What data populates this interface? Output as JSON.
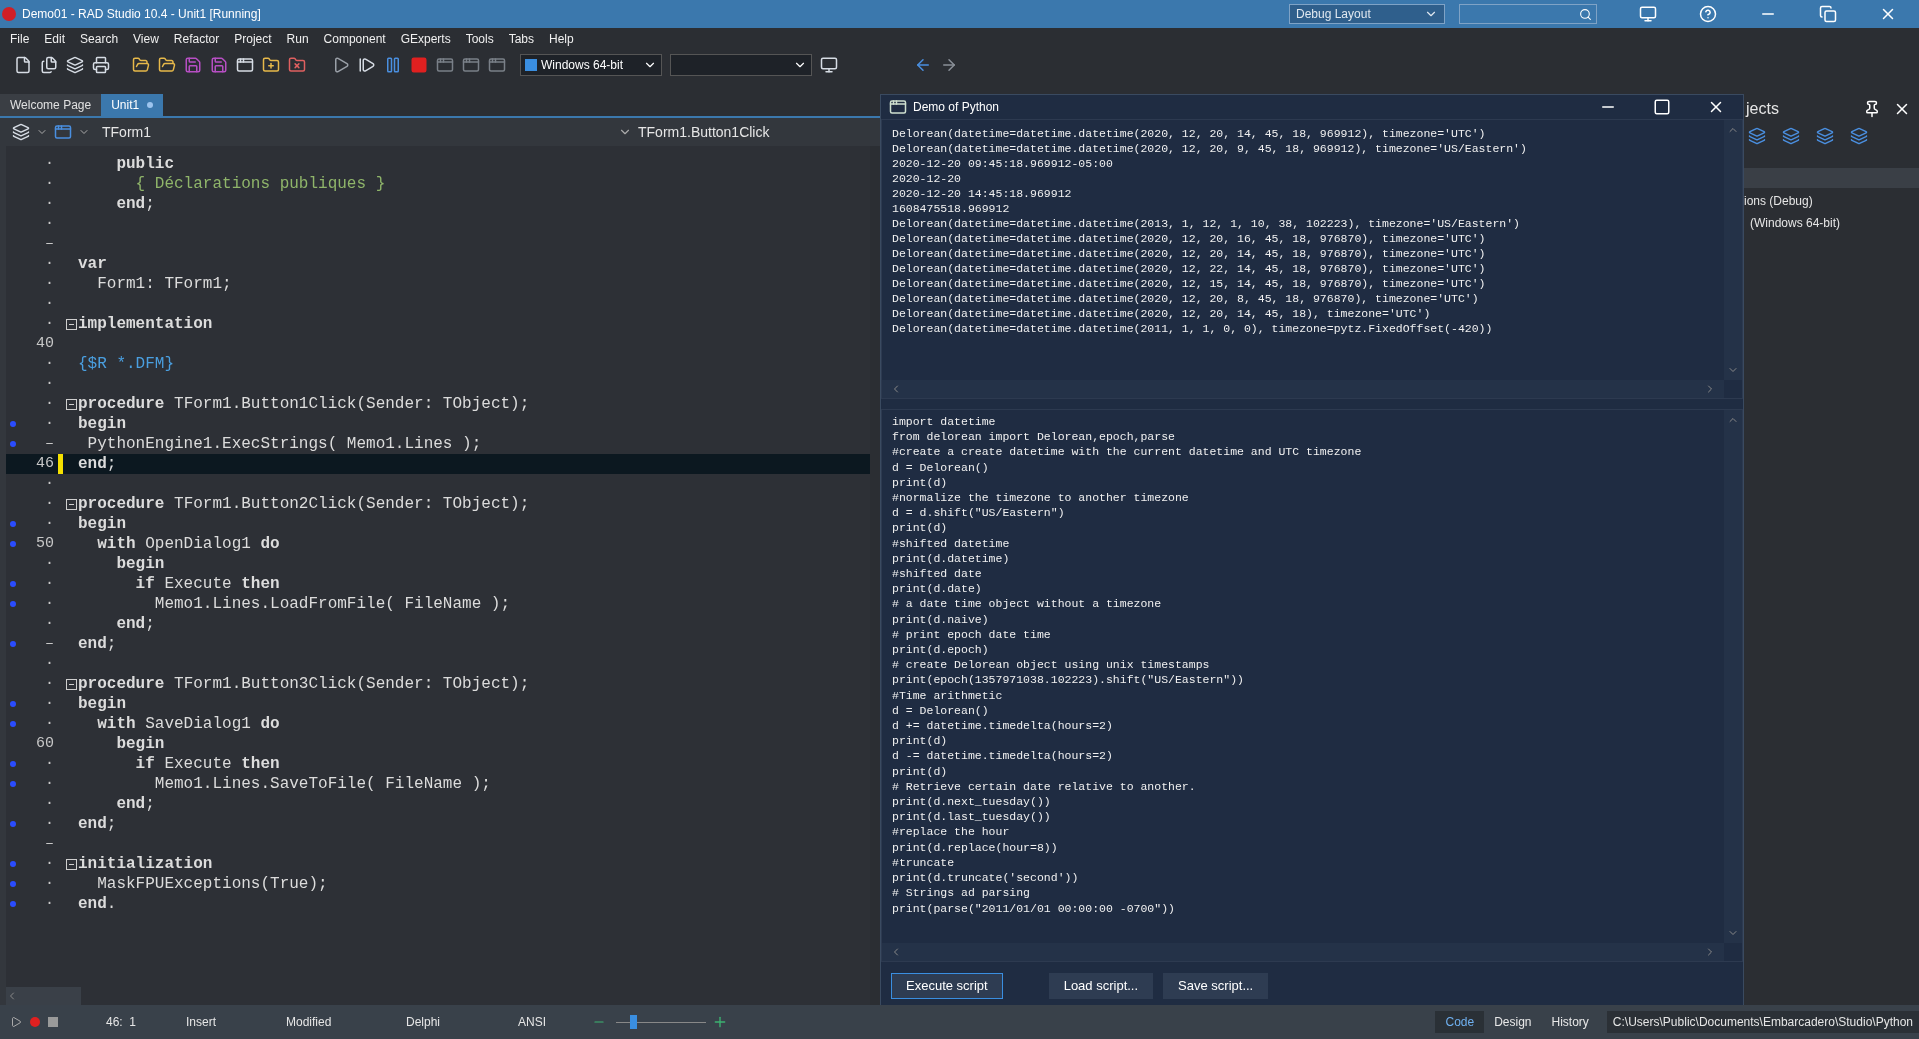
{
  "window": {
    "title": "Demo01 - RAD Studio 10.4 - Unit1 [Running]",
    "layout": "Debug Layout"
  },
  "menu": [
    "File",
    "Edit",
    "Search",
    "View",
    "Refactor",
    "Project",
    "Run",
    "Component",
    "GExperts",
    "Tools",
    "Tabs",
    "Help"
  ],
  "toolbar": {
    "platform": "Windows 64-bit"
  },
  "tabs": [
    {
      "label": "Welcome Page",
      "selected": false,
      "modified": false
    },
    {
      "label": "Unit1",
      "selected": true,
      "modified": true
    }
  ],
  "editor": {
    "class_box": "TForm1",
    "method_box": "TForm1.Button1Click",
    "lines": [
      {
        "gutter": "·",
        "breakpoint": false,
        "fold": false,
        "current": false,
        "kind": "code",
        "text": "    **public**"
      },
      {
        "gutter": "·",
        "breakpoint": false,
        "fold": false,
        "current": false,
        "kind": "comment",
        "text": "      { Déclarations publiques }"
      },
      {
        "gutter": "·",
        "breakpoint": false,
        "fold": false,
        "current": false,
        "kind": "code",
        "text": "    **end**;"
      },
      {
        "gutter": "·",
        "breakpoint": false,
        "fold": false,
        "current": false,
        "kind": "code"
      },
      {
        "gutter": "–",
        "breakpoint": false,
        "fold": false,
        "current": false,
        "kind": "code"
      },
      {
        "gutter": "·",
        "breakpoint": false,
        "fold": false,
        "current": false,
        "kind": "code",
        "text": "**var**"
      },
      {
        "gutter": "·",
        "breakpoint": false,
        "fold": false,
        "current": false,
        "kind": "code",
        "text": "  Form1: TForm1;"
      },
      {
        "gutter": "·",
        "breakpoint": false,
        "fold": false,
        "current": false,
        "kind": "code"
      },
      {
        "gutter": "·",
        "breakpoint": false,
        "fold": true,
        "current": false,
        "kind": "code",
        "text": "**implementation**"
      },
      {
        "gutter": "40",
        "breakpoint": false,
        "fold": false,
        "current": false,
        "kind": "code"
      },
      {
        "gutter": "·",
        "breakpoint": false,
        "fold": false,
        "current": false,
        "kind": "directive",
        "text": "{$R *.DFM}"
      },
      {
        "gutter": "·",
        "breakpoint": false,
        "fold": false,
        "current": false,
        "kind": "code"
      },
      {
        "gutter": "·",
        "breakpoint": false,
        "fold": true,
        "current": false,
        "kind": "code",
        "text": "**procedure** TForm1.Button1Click(Sender: TObject);"
      },
      {
        "gutter": "·",
        "breakpoint": true,
        "fold": false,
        "current": false,
        "kind": "code",
        "text": "**begin**"
      },
      {
        "gutter": "–",
        "breakpoint": true,
        "fold": false,
        "current": false,
        "kind": "code",
        "text": " PythonEngine1.ExecStrings( Memo1.Lines );"
      },
      {
        "gutter": "46",
        "breakpoint": false,
        "fold": false,
        "current": true,
        "kind": "code",
        "text": "**end**;"
      },
      {
        "gutter": "·",
        "breakpoint": false,
        "fold": false,
        "current": false,
        "kind": "code"
      },
      {
        "gutter": "·",
        "breakpoint": false,
        "fold": true,
        "current": false,
        "kind": "code",
        "text": "**procedure** TForm1.Button2Click(Sender: TObject);"
      },
      {
        "gutter": "·",
        "breakpoint": true,
        "fold": false,
        "current": false,
        "kind": "code",
        "text": "**begin**"
      },
      {
        "gutter": "50",
        "breakpoint": true,
        "fold": false,
        "current": false,
        "kind": "code",
        "text": "  **with** OpenDialog1 **do**"
      },
      {
        "gutter": "·",
        "breakpoint": false,
        "fold": false,
        "current": false,
        "kind": "code",
        "text": "    **begin**"
      },
      {
        "gutter": "·",
        "breakpoint": true,
        "fold": false,
        "current": false,
        "kind": "code",
        "text": "      **if** Execute **then**"
      },
      {
        "gutter": "·",
        "breakpoint": true,
        "fold": false,
        "current": false,
        "kind": "code",
        "text": "        Memo1.Lines.LoadFromFile( FileName );"
      },
      {
        "gutter": "·",
        "breakpoint": false,
        "fold": false,
        "current": false,
        "kind": "code",
        "text": "    **end**;"
      },
      {
        "gutter": "–",
        "breakpoint": true,
        "fold": false,
        "current": false,
        "kind": "code",
        "text": "**end**;"
      },
      {
        "gutter": "·",
        "breakpoint": false,
        "fold": false,
        "current": false,
        "kind": "code"
      },
      {
        "gutter": "·",
        "breakpoint": false,
        "fold": true,
        "current": false,
        "kind": "code",
        "text": "**procedure** TForm1.Button3Click(Sender: TObject);"
      },
      {
        "gutter": "·",
        "breakpoint": true,
        "fold": false,
        "current": false,
        "kind": "code",
        "text": "**begin**"
      },
      {
        "gutter": "·",
        "breakpoint": true,
        "fold": false,
        "current": false,
        "kind": "code",
        "text": "  **with** SaveDialog1 **do**"
      },
      {
        "gutter": "60",
        "breakpoint": false,
        "fold": false,
        "current": false,
        "kind": "code",
        "text": "    **begin**"
      },
      {
        "gutter": "·",
        "breakpoint": true,
        "fold": false,
        "current": false,
        "kind": "code",
        "text": "      **if** Execute **then**"
      },
      {
        "gutter": "·",
        "breakpoint": true,
        "fold": false,
        "current": false,
        "kind": "code",
        "text": "        Memo1.Lines.SaveToFile( FileName );"
      },
      {
        "gutter": "·",
        "breakpoint": false,
        "fold": false,
        "current": false,
        "kind": "code",
        "text": "    **end**;"
      },
      {
        "gutter": "·",
        "breakpoint": true,
        "fold": false,
        "current": false,
        "kind": "code",
        "text": "**end**;"
      },
      {
        "gutter": "–",
        "breakpoint": false,
        "fold": false,
        "current": false,
        "kind": "code"
      },
      {
        "gutter": "·",
        "breakpoint": true,
        "fold": true,
        "current": false,
        "kind": "code",
        "text": "**initialization**"
      },
      {
        "gutter": "·",
        "breakpoint": true,
        "fold": false,
        "current": false,
        "kind": "code",
        "text": "  MaskFPUExceptions(True);"
      },
      {
        "gutter": "·",
        "breakpoint": true,
        "fold": false,
        "current": false,
        "kind": "code",
        "text": "**end**."
      }
    ]
  },
  "python_window": {
    "title": "Demo of Python",
    "output": [
      "Delorean(datetime=datetime.datetime(2020, 12, 20, 14, 45, 18, 969912), timezone='UTC')",
      "Delorean(datetime=datetime.datetime(2020, 12, 20, 9, 45, 18, 969912), timezone='US/Eastern')",
      "2020-12-20 09:45:18.969912-05:00",
      "2020-12-20",
      "2020-12-20 14:45:18.969912",
      "1608475518.969912",
      "Delorean(datetime=datetime.datetime(2013, 1, 12, 1, 10, 38, 102223), timezone='US/Eastern')",
      "Delorean(datetime=datetime.datetime(2020, 12, 20, 16, 45, 18, 976870), timezone='UTC')",
      "Delorean(datetime=datetime.datetime(2020, 12, 20, 14, 45, 18, 976870), timezone='UTC')",
      "Delorean(datetime=datetime.datetime(2020, 12, 22, 14, 45, 18, 976870), timezone='UTC')",
      "Delorean(datetime=datetime.datetime(2020, 12, 15, 14, 45, 18, 976870), timezone='UTC')",
      "Delorean(datetime=datetime.datetime(2020, 12, 20, 8, 45, 18, 976870), timezone='UTC')",
      "Delorean(datetime=datetime.datetime(2020, 12, 20, 14, 45, 18), timezone='UTC')",
      "Delorean(datetime=datetime.datetime(2011, 1, 1, 0, 0), timezone=pytz.FixedOffset(-420))"
    ],
    "script": [
      "import datetime",
      "from delorean import Delorean,epoch,parse",
      "#create a create datetime with the current datetime and UTC timezone",
      "d = Delorean()",
      "print(d)",
      "#normalize the timezone to another timezone",
      "d = d.shift(\"US/Eastern\")",
      "print(d)",
      "#shifted datetime",
      "print(d.datetime)",
      "#shifted date",
      "print(d.date)",
      "# a date time object without a timezone",
      "print(d.naive)",
      "# print epoch date time",
      "print(d.epoch)",
      "# create Delorean object using unix timestamps",
      "print(epoch(1357971038.102223).shift(\"US/Eastern\"))",
      "#Time arithmetic",
      "d = Delorean()",
      "d += datetime.timedelta(hours=2)",
      "print(d)",
      "d -= datetime.timedelta(hours=2)",
      "print(d)",
      "# Retrieve certain date relative to another.",
      "print(d.next_tuesday())",
      "print(d.last_tuesday())",
      "#replace the hour",
      "print(d.replace(hour=8))",
      "#truncate",
      "print(d.truncate('second'))",
      "# Strings ad parsing",
      "print(parse(\"2011/01/01 00:00:00 -0700\"))"
    ],
    "buttons": [
      {
        "label": "Execute script",
        "selected": true
      },
      {
        "label": "Load script...",
        "selected": false
      },
      {
        "label": "Save script...",
        "selected": false
      }
    ]
  },
  "projects_panel": {
    "title": "jects",
    "items": [
      "ions (Debug)",
      "(Windows 64-bit)"
    ]
  },
  "status_bar": {
    "position": "46:  1",
    "mode": "Insert",
    "state": "Modified",
    "language": "Delphi",
    "encoding": "ANSI",
    "zoom": {
      "level": 0.15
    },
    "view_tabs": [
      {
        "label": "Code",
        "selected": true
      },
      {
        "label": "Design",
        "selected": false
      },
      {
        "label": "History",
        "selected": false
      }
    ],
    "path": "C:\\Users\\Public\\Documents\\Embarcadero\\Studio\\Python"
  }
}
